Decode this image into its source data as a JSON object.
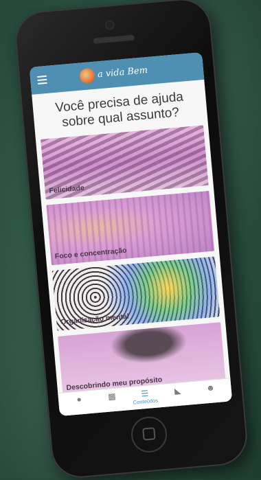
{
  "app": {
    "logo_text": "a vida Bem"
  },
  "heading": "Você precisa de ajuda sobre qual assunto?",
  "topics": [
    {
      "label": "Felicidade"
    },
    {
      "label": "Foco e concentração"
    },
    {
      "label": "Organização mental"
    },
    {
      "label": "Descobrindo meu propósito"
    }
  ],
  "nav": {
    "items": [
      {
        "icon": "chat-icon",
        "label": ""
      },
      {
        "icon": "people-icon",
        "label": ""
      },
      {
        "icon": "list-icon",
        "label": "Conteúdos",
        "active": true
      },
      {
        "icon": "chart-icon",
        "label": ""
      },
      {
        "icon": "profile-icon",
        "label": ""
      }
    ]
  },
  "colors": {
    "accent": "#4f8fb2",
    "card_overlay": "#d9a6d3",
    "background": "#2c5343"
  }
}
